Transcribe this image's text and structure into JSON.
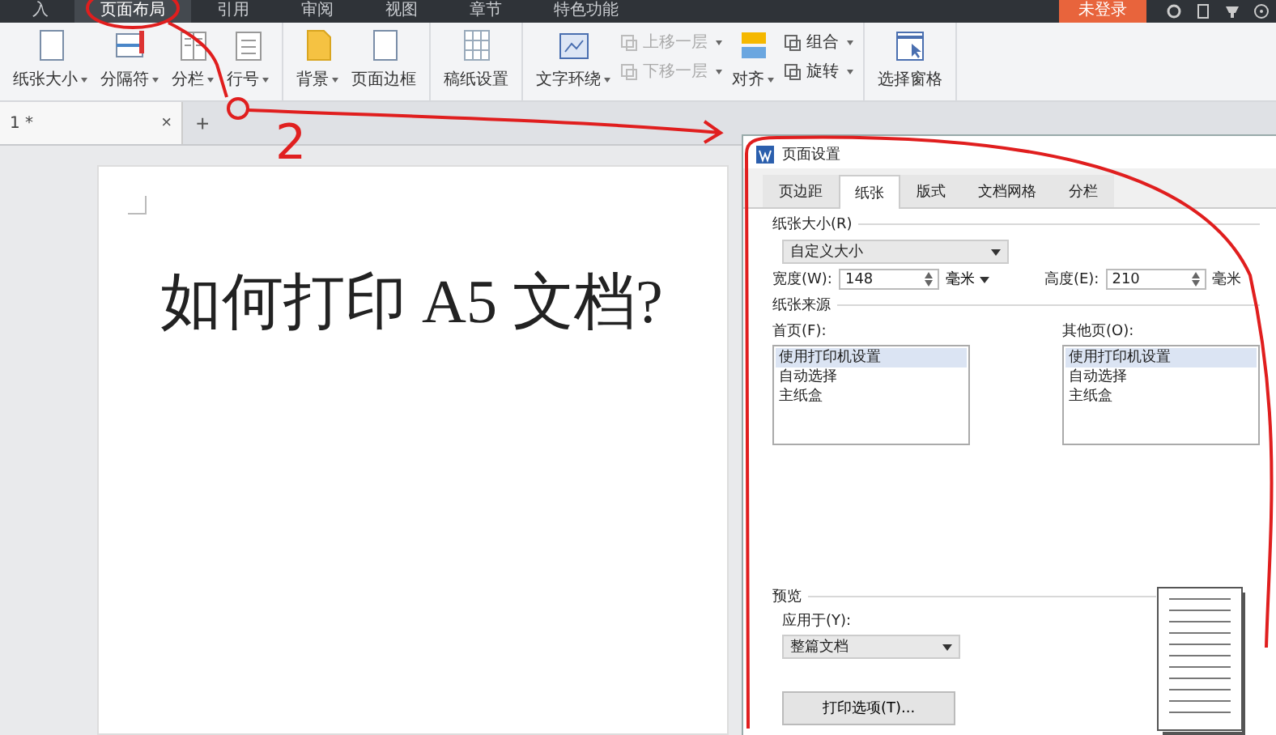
{
  "menu_tabs": [
    {
      "label": "入",
      "selected": false
    },
    {
      "label": "页面布局",
      "selected": true
    },
    {
      "label": "引用",
      "selected": false
    },
    {
      "label": "审阅",
      "selected": false
    },
    {
      "label": "视图",
      "selected": false
    },
    {
      "label": "章节",
      "selected": false
    },
    {
      "label": "特色功能",
      "selected": false
    }
  ],
  "login_button": "未登录",
  "ribbon": {
    "groups": [
      [
        {
          "kind": "large",
          "label": "纸张大小",
          "dropdown": true
        },
        {
          "kind": "large",
          "label": "分隔符",
          "dropdown": true
        },
        {
          "kind": "large",
          "label": "分栏",
          "dropdown": true
        },
        {
          "kind": "large",
          "label": "行号",
          "dropdown": true
        }
      ],
      [
        {
          "kind": "large",
          "label": "背景",
          "dropdown": true
        },
        {
          "kind": "large",
          "label": "页面边框",
          "dropdown": false
        }
      ],
      [
        {
          "kind": "large",
          "label": "稿纸设置",
          "dropdown": false
        }
      ],
      [
        {
          "kind": "large",
          "label": "文字环绕",
          "dropdown": true
        },
        {
          "kind": "stack",
          "rows": [
            {
              "label": "上移一层",
              "dropdown": true,
              "disabled": true
            },
            {
              "label": "下移一层",
              "dropdown": true,
              "disabled": true
            }
          ]
        },
        {
          "kind": "large",
          "label": "对齐",
          "dropdown": true
        },
        {
          "kind": "stack",
          "rows": [
            {
              "label": "组合",
              "dropdown": true,
              "disabled": false
            },
            {
              "label": "旋转",
              "dropdown": true,
              "disabled": false
            }
          ]
        }
      ],
      [
        {
          "kind": "large",
          "label": "选择窗格",
          "dropdown": false
        }
      ]
    ]
  },
  "doc_tab": {
    "label": "1 *",
    "close": "×",
    "add": "+"
  },
  "document": {
    "heading": "如何打印 A5 文档?"
  },
  "dialog": {
    "title": "页面设置",
    "tabs": [
      {
        "label": "页边距",
        "selected": false
      },
      {
        "label": "纸张",
        "selected": true
      },
      {
        "label": "版式",
        "selected": false
      },
      {
        "label": "文档网格",
        "selected": false
      },
      {
        "label": "分栏",
        "selected": false
      }
    ],
    "paper_size": {
      "label": "纸张大小(R)",
      "value": "自定义大小"
    },
    "width": {
      "label": "宽度(W):",
      "value": "148",
      "unit": "毫米",
      "unit_dropdown": true
    },
    "height": {
      "label": "高度(E):",
      "value": "210",
      "unit": "毫米",
      "unit_dropdown": false
    },
    "paper_source": "纸张来源",
    "first_page": {
      "label": "首页(F):",
      "options": [
        {
          "label": "使用打印机设置",
          "selected": true
        },
        {
          "label": "自动选择",
          "selected": false
        },
        {
          "label": "主纸盒",
          "selected": false
        }
      ]
    },
    "other_pages": {
      "label": "其他页(O):",
      "options": [
        {
          "label": "使用打印机设置",
          "selected": true
        },
        {
          "label": "自动选择",
          "selected": false
        },
        {
          "label": "主纸盒",
          "selected": false
        }
      ]
    },
    "preview": "预览",
    "apply_to": {
      "label": "应用于(Y):",
      "value": "整篇文档"
    },
    "print_options_button": "打印选项(T)..."
  },
  "annotation": {
    "label": "2"
  }
}
